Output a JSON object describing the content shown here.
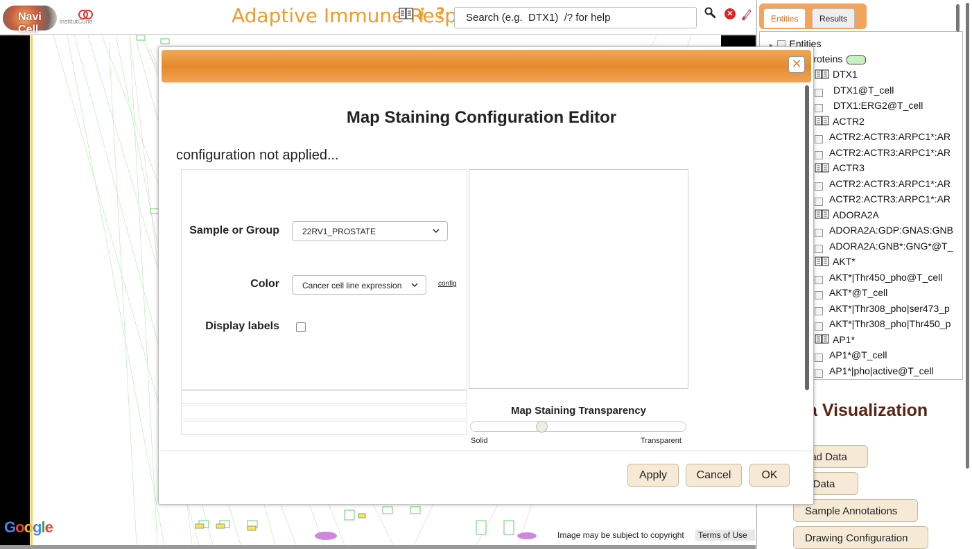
{
  "header": {
    "logo_text": "Navi Cell",
    "partner_logo_text": "institutCurie",
    "title": "Adaptive Immune Resp",
    "search_placeholder": "Search (e.g.  DTX1)  /? for help"
  },
  "map": {
    "google_label": "Google",
    "copyright": "Image may be subject to copyright",
    "terms": "Terms of Use"
  },
  "right_panel": {
    "tabs": [
      "Entities",
      "Results"
    ],
    "tree": {
      "root": "Entities",
      "group": "Proteins",
      "group_color": "#c7f1c0",
      "items": [
        {
          "label": "DTX1",
          "type": "book"
        },
        {
          "label": "DTX1@T_cell",
          "type": "leaf"
        },
        {
          "label": "DTX1:ERG2@T_cell",
          "type": "leaf"
        },
        {
          "label": "ACTR2",
          "type": "book"
        },
        {
          "label": "ACTR2:ACTR3:ARPC1*:AR",
          "type": "leaf"
        },
        {
          "label": "ACTR2:ACTR3:ARPC1*:AR",
          "type": "leaf"
        },
        {
          "label": "ACTR3",
          "type": "book"
        },
        {
          "label": "ACTR2:ACTR3:ARPC1*:AR",
          "type": "leaf"
        },
        {
          "label": "ACTR2:ACTR3:ARPC1*:AR",
          "type": "leaf"
        },
        {
          "label": "ADORA2A",
          "type": "book"
        },
        {
          "label": "ADORA2A:GDP:GNAS:GNB",
          "type": "leaf"
        },
        {
          "label": "ADORA2A:GNB*:GNG*@T_",
          "type": "leaf"
        },
        {
          "label": "AKT*",
          "type": "book"
        },
        {
          "label": "AKT*|Thr450_pho@T_cell",
          "type": "leaf"
        },
        {
          "label": "AKT*@T_cell",
          "type": "leaf"
        },
        {
          "label": "AKT*|Thr308_pho|ser473_p",
          "type": "leaf"
        },
        {
          "label": "AKT*|Thr308_pho|Thr450_p",
          "type": "leaf"
        },
        {
          "label": "AP1*",
          "type": "book"
        },
        {
          "label": "AP1*@T_cell",
          "type": "leaf"
        },
        {
          "label": "AP1*|pho|active@T_cell",
          "type": "leaf"
        }
      ]
    },
    "data_vis_title": "a Visualization",
    "buttons": [
      "oad Data",
      "y Data",
      "Sample Annotations",
      "Drawing Configuration"
    ]
  },
  "dialog": {
    "title": "Map Staining Configuration Editor",
    "status": "configuration not applied...",
    "sample_label": "Sample or Group",
    "sample_value": "22RV1_PROSTATE",
    "color_label": "Color",
    "color_value": "Cancer cell line expression",
    "config_link": "config",
    "display_labels_label": "Display labels",
    "display_labels_checked": false,
    "transparency_title": "Map Staining Transparency",
    "transparency_value": 0.33,
    "solid_label": "Solid",
    "transparent_label": "Transparent",
    "close_icon": "close-icon",
    "buttons": {
      "apply": "Apply",
      "cancel": "Cancel",
      "ok": "OK"
    },
    "accent": "#e48a2b"
  }
}
